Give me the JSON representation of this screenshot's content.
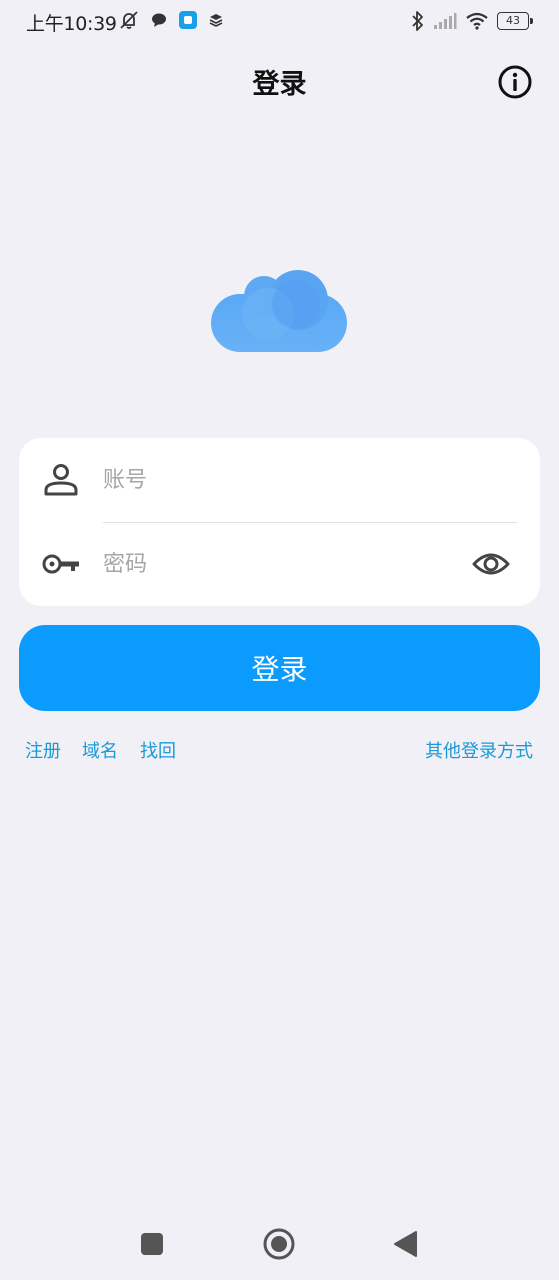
{
  "status_bar": {
    "time": "上午10:39",
    "battery": "43",
    "icons_left": [
      "mute-alarm-icon",
      "chat-bubble-icon",
      "app-square-icon",
      "layers-icon"
    ],
    "icons_right": [
      "bluetooth-icon",
      "signal-icon",
      "wifi-icon",
      "battery-icon"
    ]
  },
  "header": {
    "title": "登录",
    "info_icon": "info-icon"
  },
  "logo": {
    "icon": "cloud-icon",
    "color": "#5aa9f6"
  },
  "form": {
    "account": {
      "placeholder": "账号",
      "value": "",
      "icon": "person-icon"
    },
    "password": {
      "placeholder": "密码",
      "value": "",
      "icon": "key-icon",
      "toggle_icon": "eye-icon"
    }
  },
  "login_button": {
    "label": "登录",
    "color": "#0a9bfd"
  },
  "links": {
    "register": "注册",
    "domain": "域名",
    "recover": "找回",
    "other_login": "其他登录方式",
    "color": "#1a9ad6"
  },
  "system_nav": {
    "buttons": [
      "recents-square-icon",
      "home-circle-icon",
      "back-triangle-icon"
    ]
  }
}
